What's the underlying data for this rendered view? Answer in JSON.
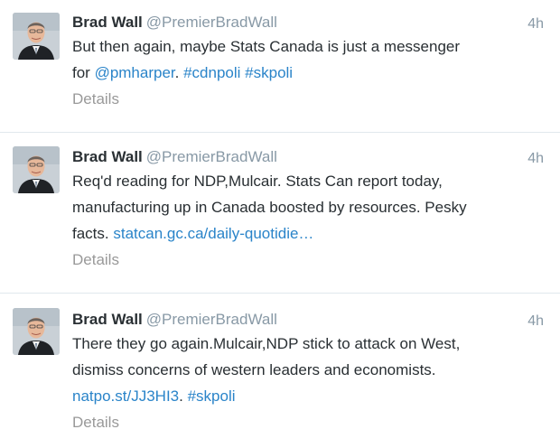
{
  "tweets": [
    {
      "fullname": "Brad Wall",
      "username": "@PremierBradWall",
      "time": "4h",
      "text_1": "But then again, maybe Stats Canada is just a messenger",
      "text_2_prefix": "for ",
      "mention": "@pmharper",
      "text_2_sep": ". ",
      "hashtag_1": "#cdnpoli",
      "text_2_sep2": " ",
      "hashtag_2": "#skpoli",
      "details": "Details"
    },
    {
      "fullname": "Brad Wall",
      "username": "@PremierBradWall",
      "time": "4h",
      "text_1": "Req'd reading for NDP,Mulcair. Stats Can report today,",
      "text_2": "manufacturing up in Canada boosted by resources. Pesky",
      "text_3_prefix": "facts. ",
      "link": "statcan.gc.ca/daily-quotidie…",
      "details": "Details"
    },
    {
      "fullname": "Brad Wall",
      "username": "@PremierBradWall",
      "time": "4h",
      "text_1": "There they go again.Mulcair,NDP stick to attack on West,",
      "text_2": "dismiss concerns of western leaders and economists.",
      "link": "natpo.st/JJ3HI3",
      "text_3_sep": ". ",
      "hashtag": "#skpoli",
      "details": "Details"
    }
  ],
  "colors": {
    "link": "#2a84c9",
    "name": "#292f33",
    "muted": "#8899a6",
    "details": "#999999",
    "divider": "#e1e8ed"
  }
}
